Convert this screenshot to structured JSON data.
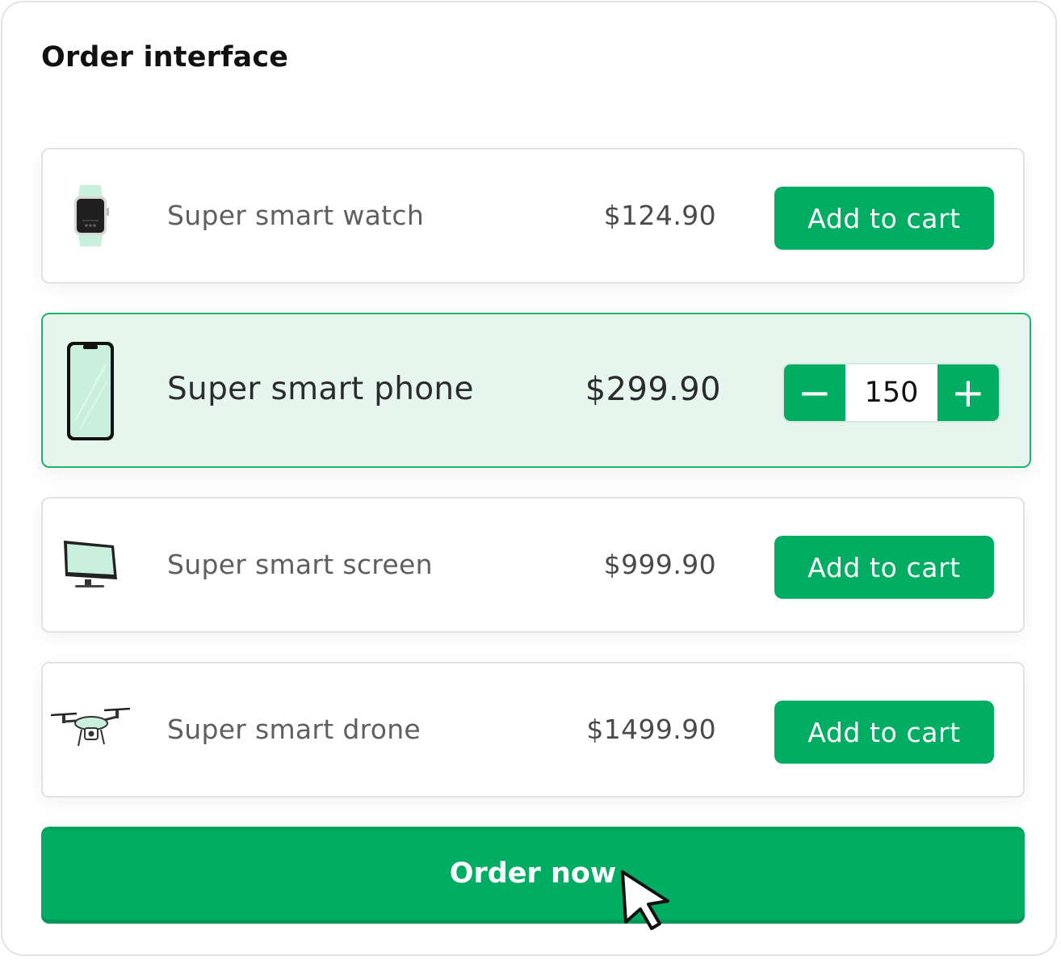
{
  "page": {
    "title": "Order interface"
  },
  "products": [
    {
      "name": "Super smart watch",
      "price": "$124.90",
      "action_label": "Add to cart",
      "icon": "smartwatch-icon",
      "selected": false
    },
    {
      "name": "Super smart phone",
      "price": "$299.90",
      "icon": "smartphone-icon",
      "selected": true,
      "quantity": "150",
      "decrement_symbol": "−",
      "increment_symbol": "+"
    },
    {
      "name": "Super smart screen",
      "price": "$999.90",
      "action_label": "Add to cart",
      "icon": "monitor-icon",
      "selected": false
    },
    {
      "name": "Super smart drone",
      "price": "$1499.90",
      "action_label": "Add to cart",
      "icon": "drone-icon",
      "selected": false
    }
  ],
  "order_button": {
    "label": "Order now"
  },
  "colors": {
    "accent": "#00ad62",
    "selected_background": "#e6f6ef",
    "selected_border": "#22b36b",
    "icon_tint": "#c8f0dc"
  },
  "icons": {
    "cursor": "arrow-cursor-icon"
  }
}
